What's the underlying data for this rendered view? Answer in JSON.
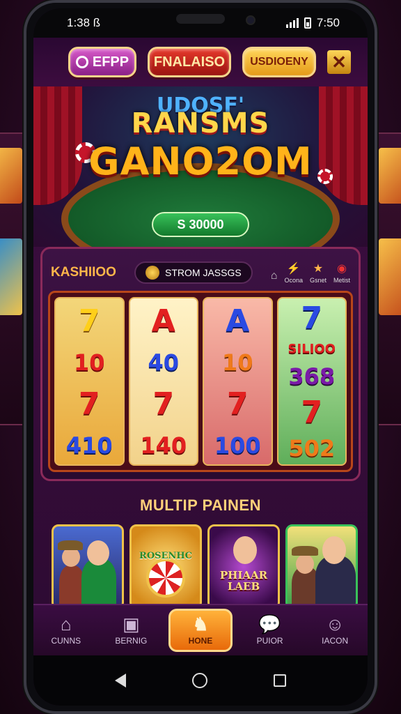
{
  "status_bar": {
    "time": "1:38 ß",
    "clock_right": "7:50"
  },
  "topbar": {
    "btn_left": "EFPP",
    "btn_center": "FNALAISO",
    "btn_right": "USDIOENY",
    "close_icon": "close-icon"
  },
  "hero": {
    "logo_top": "UDOSF'",
    "logo_line1": "RANSMS",
    "logo_line2": "GANO2OM",
    "prize": "S 30000"
  },
  "slots": {
    "title": "KASHIIOO",
    "balance": "STROM JASSGS",
    "mini_icons": [
      {
        "icon": "house-icon",
        "label": ""
      },
      {
        "icon": "bolt-icon",
        "label": "Ocona"
      },
      {
        "icon": "star-icon",
        "label": "Gsnet"
      },
      {
        "icon": "chip-icon",
        "label": "Metist"
      }
    ],
    "reels": [
      {
        "top": "7",
        "mid": "10",
        "sym": "7",
        "bottom": "410"
      },
      {
        "top": "A",
        "mid": "40",
        "sym": "7",
        "bottom": "140"
      },
      {
        "top": "A",
        "mid": "10",
        "sym": "7",
        "bottom": "100"
      },
      {
        "top": "7",
        "mid": "SILIOO",
        "mid2": "368",
        "sym": "7",
        "bottom": "502"
      }
    ]
  },
  "section": {
    "title": "MULTIP PAINEN"
  },
  "cards": [
    {
      "label": ""
    },
    {
      "label": "ROSENHC"
    },
    {
      "label": "PHIAAR LAEB"
    },
    {
      "label": ""
    }
  ],
  "bottom_nav": [
    {
      "label": "CUNNS",
      "icon": "home-icon"
    },
    {
      "label": "BERNIG",
      "icon": "camera-icon"
    },
    {
      "label": "HONE",
      "icon": "lion-icon"
    },
    {
      "label": "PUIOR",
      "icon": "chat-icon"
    },
    {
      "label": "IACON",
      "icon": "user-icon"
    }
  ],
  "colors": {
    "accent": "#ffb23a",
    "panel": "#3d1244",
    "frame": "#8a2a5a"
  }
}
